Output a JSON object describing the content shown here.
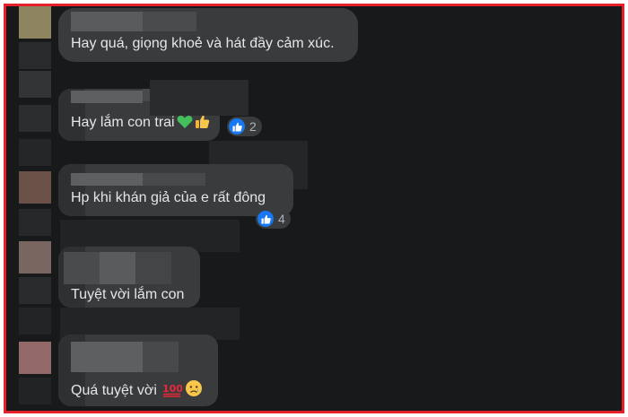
{
  "comments": [
    {
      "text": "Hay quá, giọng khoẻ và hát đầy cảm xúc."
    },
    {
      "text": "Hay lắm con trai",
      "reaction": {
        "type": "like",
        "count": "2"
      },
      "emojis": [
        "green-heart",
        "thumbs-up"
      ]
    },
    {
      "text": "Hp khi khán giả của e rất đông",
      "reaction": {
        "type": "like",
        "count": "4"
      }
    },
    {
      "text": "Tuyệt vời lắm con"
    },
    {
      "text": "Quá tuyệt vời",
      "emojis": [
        "hundred-points",
        "sad-face"
      ]
    }
  ],
  "colors": {
    "frame_border": "#e5202a",
    "background": "#18191a",
    "bubble": "#3a3b3c",
    "text": "#e4e6eb",
    "like_blue": "#1877f2"
  }
}
